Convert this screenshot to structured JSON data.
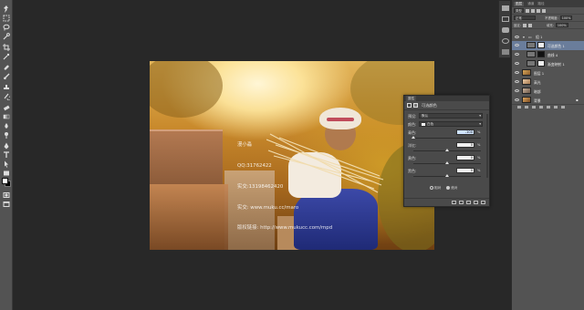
{
  "layers_panel": {
    "tabs": [
      "图层",
      "通道",
      "路径"
    ],
    "active_tab": "图层",
    "kind_label": "类型",
    "blend_mode": "正常",
    "opacity_label": "不透明度:",
    "opacity_value": "100%",
    "lock_label": "锁定:",
    "fill_label": "填充:",
    "fill_value": "100%",
    "group_name": "组 1",
    "layers": [
      {
        "name": "可选颜色 1",
        "kind": "adjustment",
        "selected": true
      },
      {
        "name": "曲线 4",
        "kind": "adjustment",
        "selected": false
      },
      {
        "name": "渐变映射 1",
        "kind": "adjustment",
        "selected": false
      },
      {
        "name": "图层 1",
        "kind": "pixel",
        "selected": false
      },
      {
        "name": "高光",
        "kind": "pixel",
        "selected": false
      },
      {
        "name": "暗部",
        "kind": "pixel",
        "selected": false
      },
      {
        "name": "背景",
        "kind": "pixel",
        "selected": false
      }
    ]
  },
  "properties_panel": {
    "tab": "属性",
    "title": "可选颜色",
    "preset_label": "预设:",
    "preset_value": "默认",
    "colors_label": "颜色:",
    "colors_value": "白色",
    "rows": [
      {
        "label": "青色:",
        "value": "-100",
        "unit": "%",
        "selected": true,
        "slider": 0.0
      },
      {
        "label": "洋红:",
        "value": "0",
        "unit": "%",
        "selected": false,
        "slider": 0.5
      },
      {
        "label": "黄色:",
        "value": "0",
        "unit": "%",
        "selected": false,
        "slider": 0.5
      },
      {
        "label": "黑色:",
        "value": "0",
        "unit": "%",
        "selected": false,
        "slider": 0.5
      }
    ],
    "method_relative": "相对",
    "method_absolute": "绝对",
    "method_selected": "absolute"
  },
  "canvas": {
    "watermark_lines": [
      "漫小淼",
      "QQ:31762422",
      "实交:13198462420",
      "实交: www.muku.cc/maro",
      "版权链接: http://www.mukucc.com/mpd"
    ]
  },
  "colors": {
    "ui_dark": "#282828",
    "panel": "#535353",
    "selection": "#6a7d9b",
    "dress": "#2a37a0"
  },
  "icons": [
    "move-icon",
    "marquee-icon",
    "lasso-icon",
    "quick-select-icon",
    "crop-icon",
    "eyedropper-icon",
    "healing-icon",
    "brush-icon",
    "stamp-icon",
    "history-brush-icon",
    "eraser-icon",
    "gradient-icon",
    "blur-icon",
    "dodge-icon",
    "pen-icon",
    "type-icon",
    "path-select-icon",
    "shape-icon",
    "hand-icon",
    "zoom-icon",
    "eye-icon",
    "lock-icon"
  ]
}
